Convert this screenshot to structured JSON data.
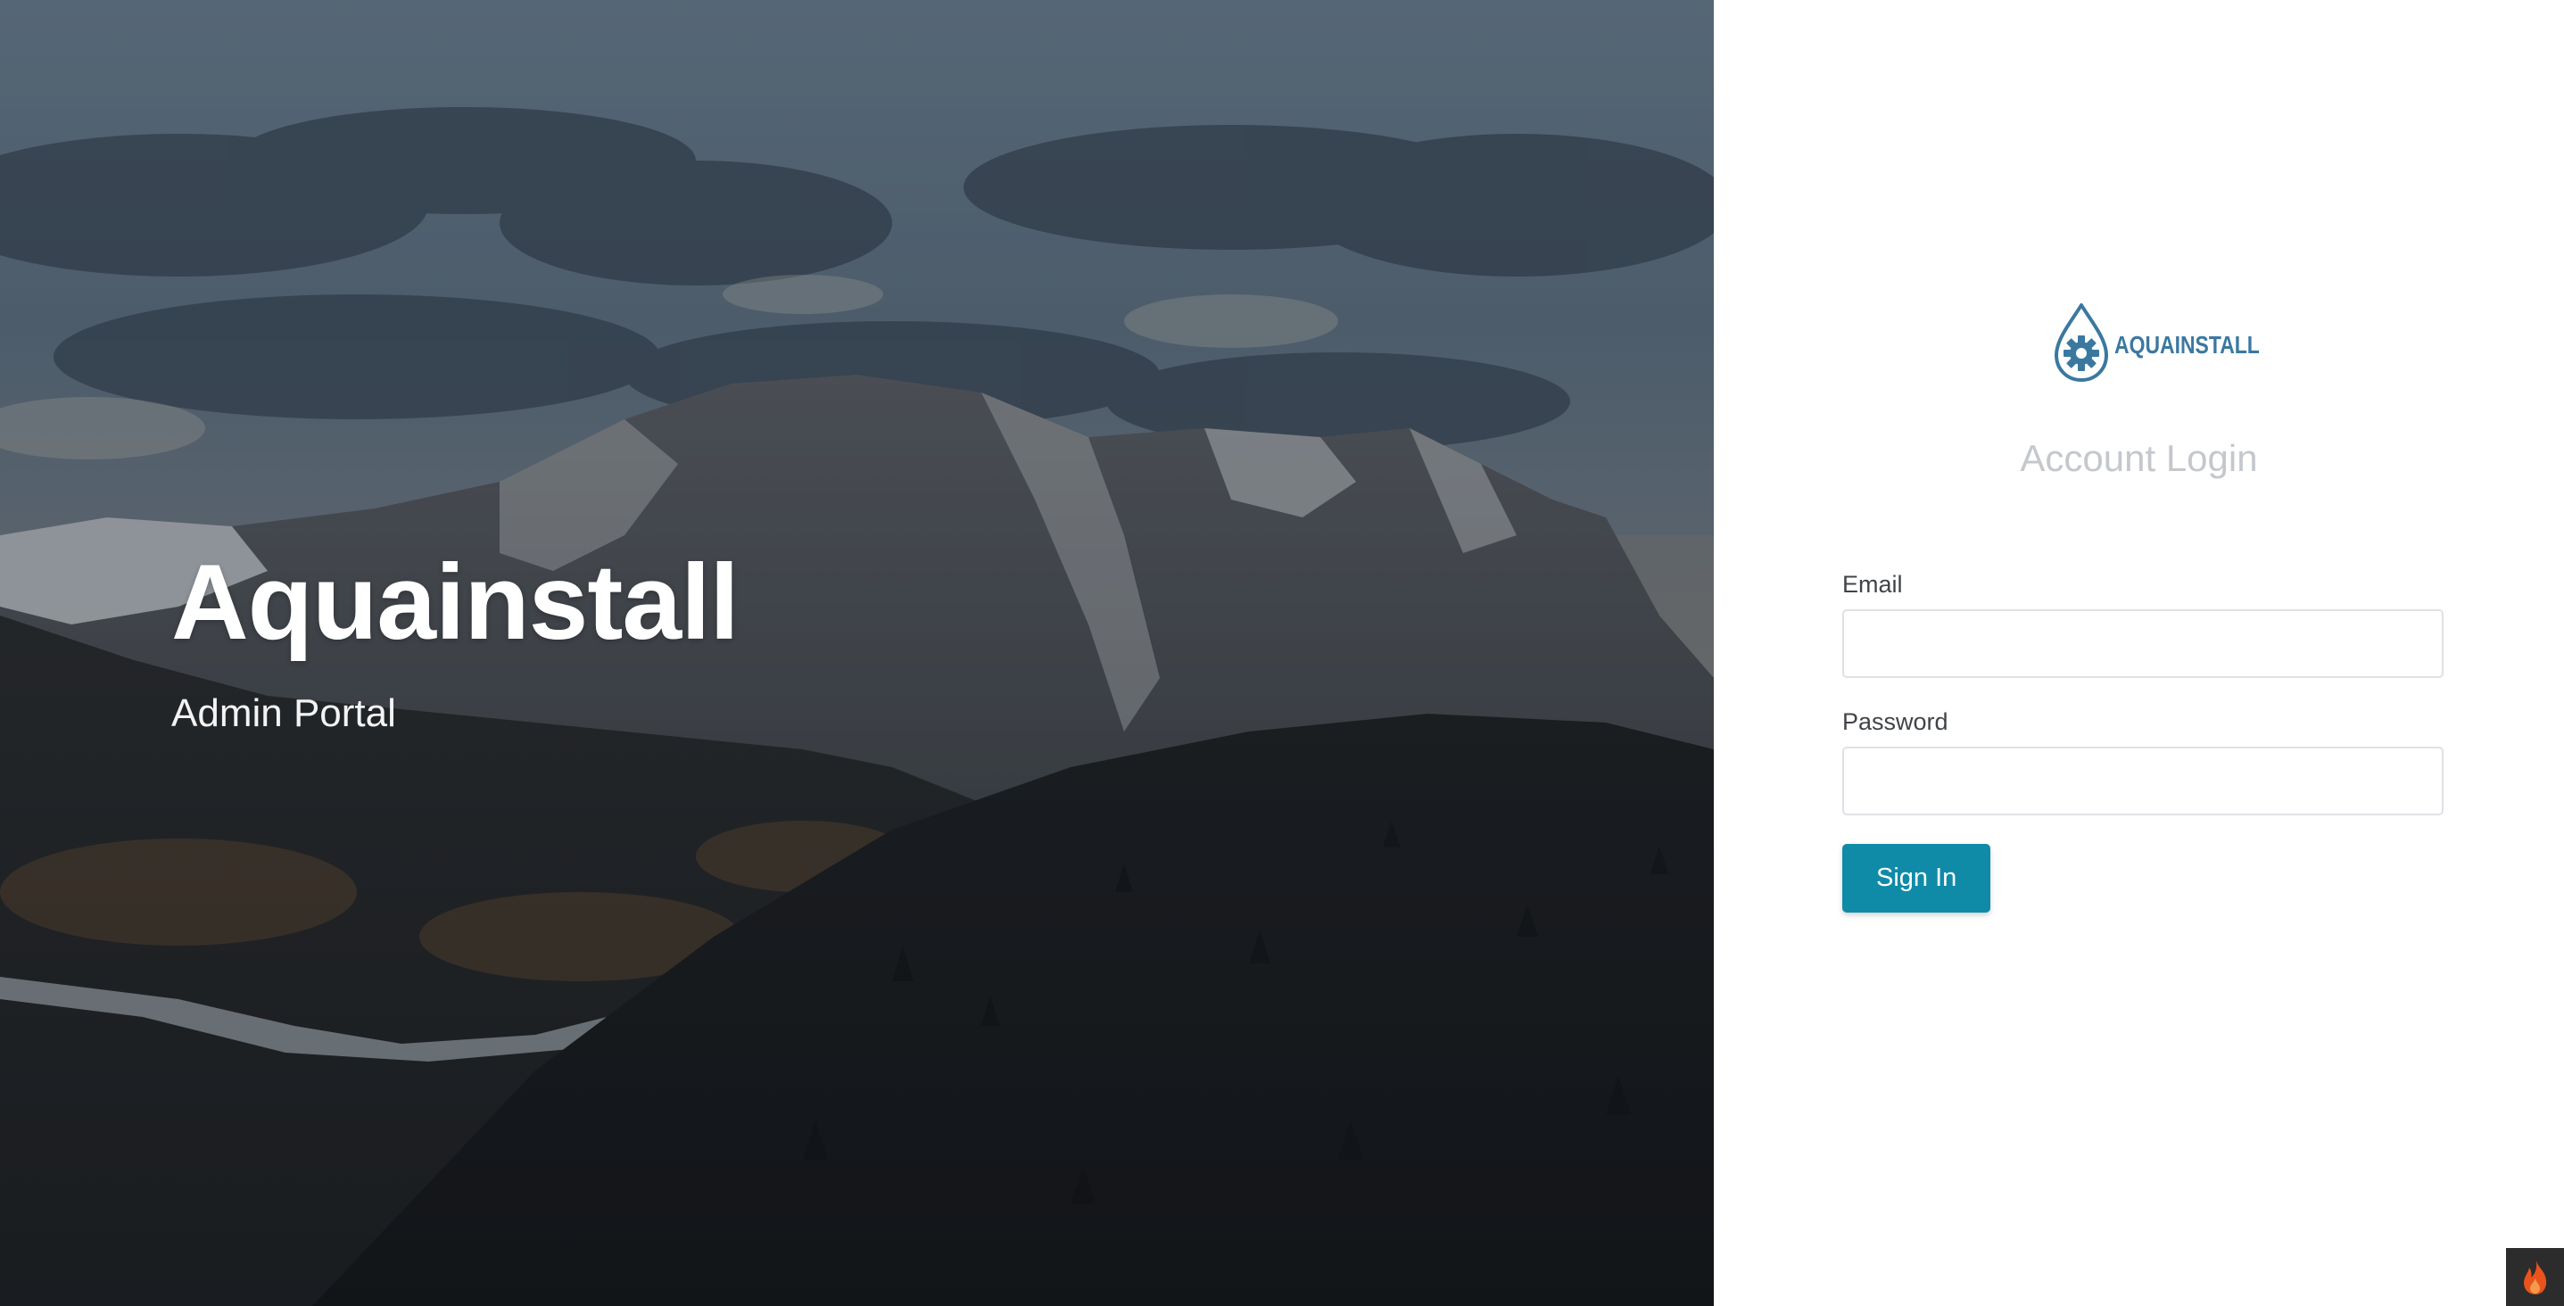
{
  "hero": {
    "title": "Aquainstall",
    "subtitle": "Admin Portal"
  },
  "login": {
    "logo_text": "AQUAINSTALL",
    "heading": "Account Login",
    "email_label": "Email",
    "email_value": "",
    "email_placeholder": "",
    "password_label": "Password",
    "password_value": "",
    "password_placeholder": "",
    "submit_label": "Sign In"
  },
  "icons": {
    "logo": "water-drop-gear-icon",
    "debug": "flame-icon"
  },
  "colors": {
    "accent": "#0f8ba8",
    "logo": "#3b78a0",
    "heading": "#c4c8cc",
    "debug_flame": "#e8531e"
  }
}
